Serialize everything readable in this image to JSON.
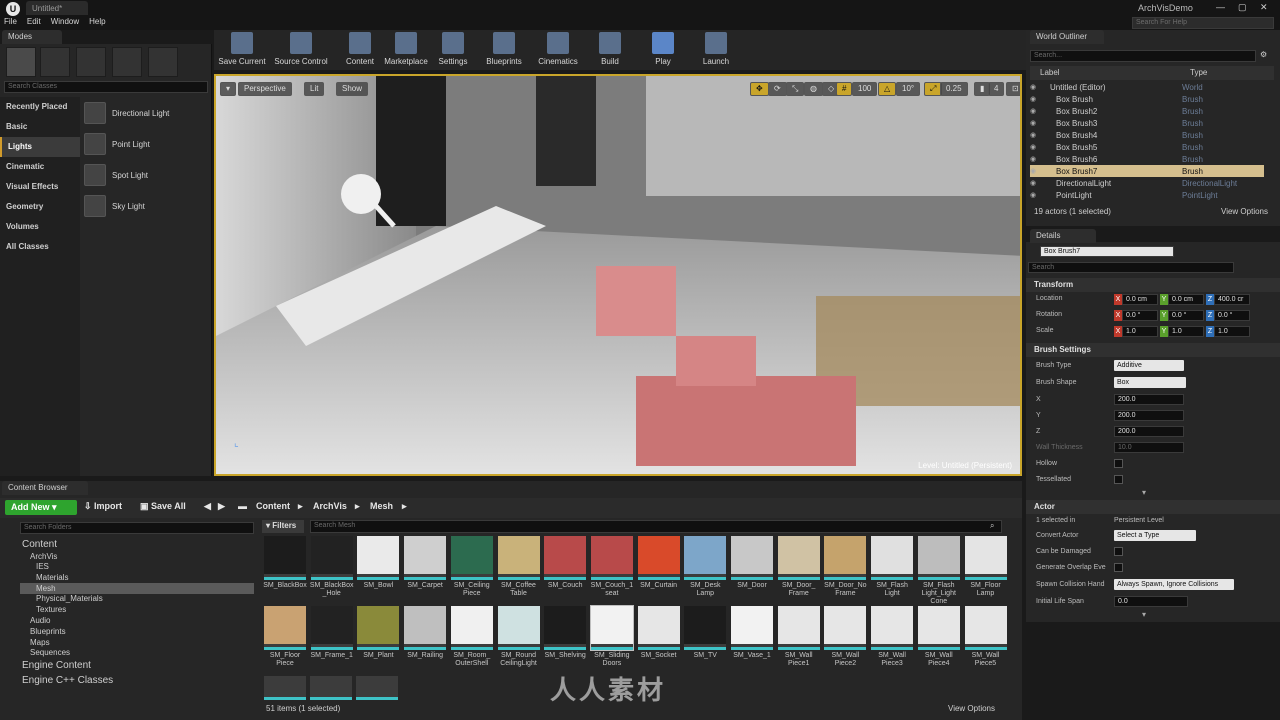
{
  "app": {
    "tab_title": "Untitled*",
    "project_name": "ArchVisDemo",
    "search_help_placeholder": "Search For Help",
    "menu": [
      "File",
      "Edit",
      "Window",
      "Help"
    ]
  },
  "modes": {
    "tab": "Modes",
    "search_placeholder": "Search Classes",
    "categories": [
      "Recently Placed",
      "Basic",
      "Lights",
      "Cinematic",
      "Visual Effects",
      "Geometry",
      "Volumes",
      "All Classes"
    ],
    "selected_category": "Lights",
    "lights": [
      "Directional Light",
      "Point Light",
      "Spot Light",
      "Sky Light"
    ]
  },
  "toolbar": {
    "buttons": [
      "Save Current",
      "Source Control",
      "Content",
      "Marketplace",
      "Settings",
      "Blueprints",
      "Cinematics",
      "Build",
      "Play",
      "Launch"
    ]
  },
  "viewport": {
    "perspective": "Perspective",
    "lit": "Lit",
    "show": "Show",
    "grid_snap": "100",
    "rot_snap": "10°",
    "scale_snap": "0.25",
    "cam_speed": "4",
    "level_label": "Level:  Untitled (Persistent)"
  },
  "outliner": {
    "tab": "World Outliner",
    "search_placeholder": "Search...",
    "col_label": "Label",
    "col_type": "Type",
    "rows": [
      {
        "label": "Untitled (Editor)",
        "type": "World"
      },
      {
        "label": "Box Brush",
        "type": "Brush"
      },
      {
        "label": "Box Brush2",
        "type": "Brush"
      },
      {
        "label": "Box Brush3",
        "type": "Brush"
      },
      {
        "label": "Box Brush4",
        "type": "Brush"
      },
      {
        "label": "Box Brush5",
        "type": "Brush"
      },
      {
        "label": "Box Brush6",
        "type": "Brush"
      },
      {
        "label": "Box Brush7",
        "type": "Brush"
      },
      {
        "label": "DirectionalLight",
        "type": "DirectionalLight"
      },
      {
        "label": "PointLight",
        "type": "PointLight"
      }
    ],
    "selected_row": 7,
    "footer": "19 actors (1 selected)",
    "view_options": "View Options"
  },
  "details": {
    "tab": "Details",
    "name_value": "Box Brush7",
    "search_placeholder": "Search",
    "transform": {
      "title": "Transform",
      "location_label": "Location",
      "location": [
        "0.0 cm",
        "0.0 cm",
        "400.0 cr"
      ],
      "rotation_label": "Rotation",
      "rotation": [
        "0.0 °",
        "0.0 °",
        "0.0 °"
      ],
      "scale_label": "Scale",
      "scale": [
        "1.0",
        "1.0",
        "1.0"
      ]
    },
    "brush": {
      "title": "Brush Settings",
      "type_label": "Brush Type",
      "type_value": "Additive",
      "shape_label": "Brush Shape",
      "shape_value": "Box",
      "x_label": "X",
      "x": "200.0",
      "y_label": "Y",
      "y": "200.0",
      "z_label": "Z",
      "z": "200.0",
      "wall_label": "Wall Thickness",
      "wall": "10.0",
      "hollow_label": "Hollow",
      "tess_label": "Tessellated"
    },
    "actor": {
      "title": "Actor",
      "selected_in_label": "1 selected in",
      "selected_in_value": "Persistent Level",
      "convert_label": "Convert Actor",
      "convert_value": "Select a Type",
      "damage_label": "Can be Damaged",
      "overlap_label": "Generate Overlap Eve",
      "spawn_label": "Spawn Collision Hand",
      "spawn_value": "Always Spawn, Ignore Collisions",
      "life_label": "Initial Life Span",
      "life_value": "0.0"
    }
  },
  "content_browser": {
    "tab": "Content Browser",
    "add_new": "Add New",
    "import": "Import",
    "save_all": "Save All",
    "path": [
      "Content",
      "ArchVis",
      "Mesh"
    ],
    "search_folders_placeholder": "Search Folders",
    "filters": "Filters",
    "search_mesh_placeholder": "Search Mesh",
    "tree": [
      "Content",
      "ArchVis",
      "IES",
      "Materials",
      "Mesh",
      "Physical_Materials",
      "Textures",
      "Audio",
      "Blueprints",
      "Maps",
      "Sequences",
      "Engine Content",
      "Engine C++ Classes"
    ],
    "assets_row1": [
      "SM_BlackBox",
      "SM_BlackBox\n_Hole",
      "SM_Bowl",
      "SM_Carpet",
      "SM_Ceiling\nPiece",
      "SM_Coffee\nTable",
      "SM_Couch",
      "SM_Couch_1\nseat",
      "SM_Curtain",
      "SM_Desk\nLamp",
      "SM_Door",
      "SM_Door_\nFrame",
      "SM_Door_No\nFrame",
      "SM_Flash\nLight",
      "SM_Flash\nLight_Light\nCone",
      "SM_Floor\nLamp"
    ],
    "assets_row2": [
      "SM_Floor\nPiece",
      "SM_Frame_1",
      "SM_Plant",
      "SM_Railing",
      "SM_Room_\nOuterShell",
      "SM_Round\nCeilingLight",
      "SM_Shelving",
      "SM_Sliding\nDoors",
      "SM_Socket",
      "SM_TV",
      "SM_Vase_1",
      "SM_Wall\nPiece1",
      "SM_Wall\nPiece2",
      "SM_Wall\nPiece3",
      "SM_Wall\nPiece4",
      "SM_Wall\nPiece5"
    ],
    "status": "51 items (1 selected)",
    "view_options": "View Options"
  },
  "watermark": "人人素材",
  "colors": {
    "accent_yellow": "#c9a52a",
    "selection": "#d5bf8e",
    "add_new_green": "#2ea42e",
    "asset_underline": "#3ec3c7"
  }
}
